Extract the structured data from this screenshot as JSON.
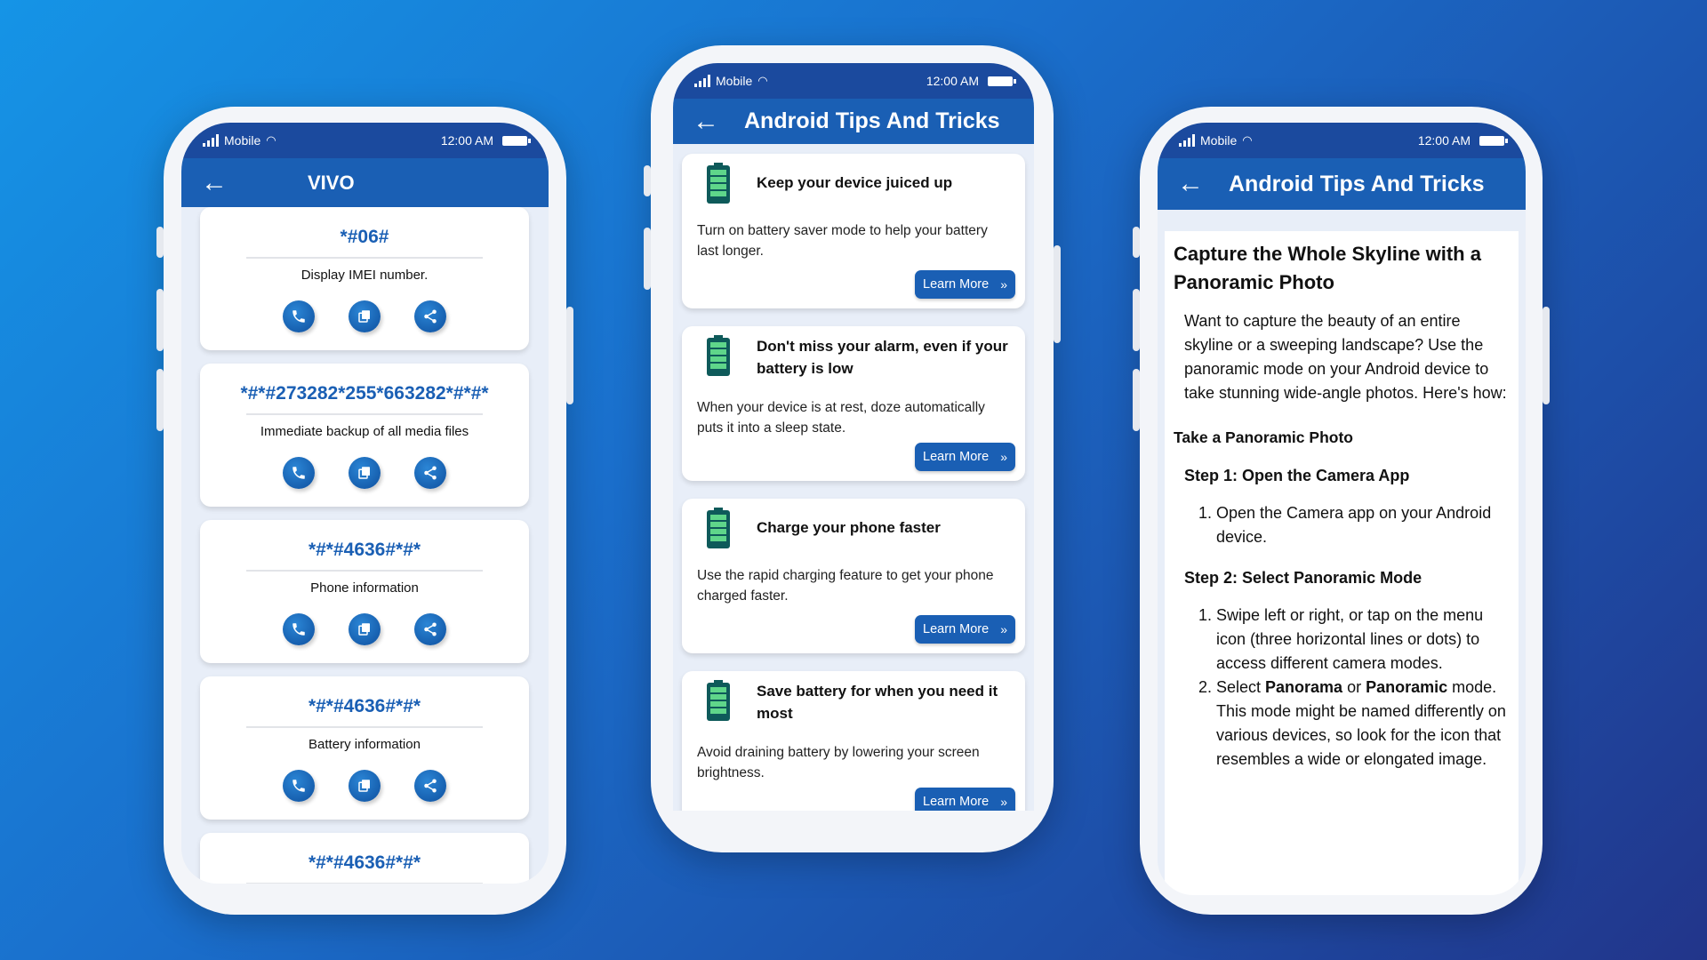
{
  "status": {
    "network": "Mobile",
    "time": "12:00 AM"
  },
  "left": {
    "title": "VIVO",
    "codes": [
      {
        "code": "*#06#",
        "desc": "Display IMEI number."
      },
      {
        "code": "*#*#273282*255*663282*#*#*",
        "desc": "Immediate backup of all media files"
      },
      {
        "code": "*#*#4636#*#*",
        "desc": "Phone information"
      },
      {
        "code": "*#*#4636#*#*",
        "desc": "Battery information"
      },
      {
        "code": "*#*#4636#*#*",
        "desc": ""
      }
    ]
  },
  "middle": {
    "title": "Android Tips And Tricks",
    "learn_more": "Learn More",
    "tips": [
      {
        "title": "Keep your device juiced up",
        "desc": "Turn on battery saver mode to help your battery last longer."
      },
      {
        "title": "Don't miss your alarm, even if your battery is low",
        "desc": "When your device is at rest, doze automatically puts it into a sleep state."
      },
      {
        "title": "Charge your phone faster",
        "desc": "Use the rapid charging feature to get your phone charged faster."
      },
      {
        "title": "Save battery for when you need it most",
        "desc": "Avoid draining battery by lowering your screen brightness."
      }
    ]
  },
  "right": {
    "title": "Android Tips And Tricks",
    "heading": "Capture the Whole Skyline with a Panoramic Photo",
    "intro": "Want to capture the beauty of an entire skyline or a sweeping landscape? Use the panoramic mode on your Android device to take stunning wide-angle photos. Here's how:",
    "section": "Take a Panoramic Photo",
    "step1": {
      "title": "Step 1: Open the Camera App",
      "items": [
        "Open the Camera app on your Android device."
      ]
    },
    "step2": {
      "title": "Step 2: Select Panoramic Mode",
      "item1": "Swipe left or right, or tap on the menu icon (three horizontal lines or dots) to access different camera modes.",
      "item2_pre": "Select ",
      "item2_b1": "Panorama",
      "item2_mid": " or ",
      "item2_b2": "Panoramic",
      "item2_post": " mode. This mode might be named differently on various devices, so look for the icon that resembles a wide or elongated image."
    }
  },
  "colors": {
    "header": "#1a5fb4",
    "status_bar": "#1b4a9e",
    "screen_bg": "#e8eef8",
    "battery_green": "#5fd68a",
    "battery_dark": "#0e5a5a"
  }
}
